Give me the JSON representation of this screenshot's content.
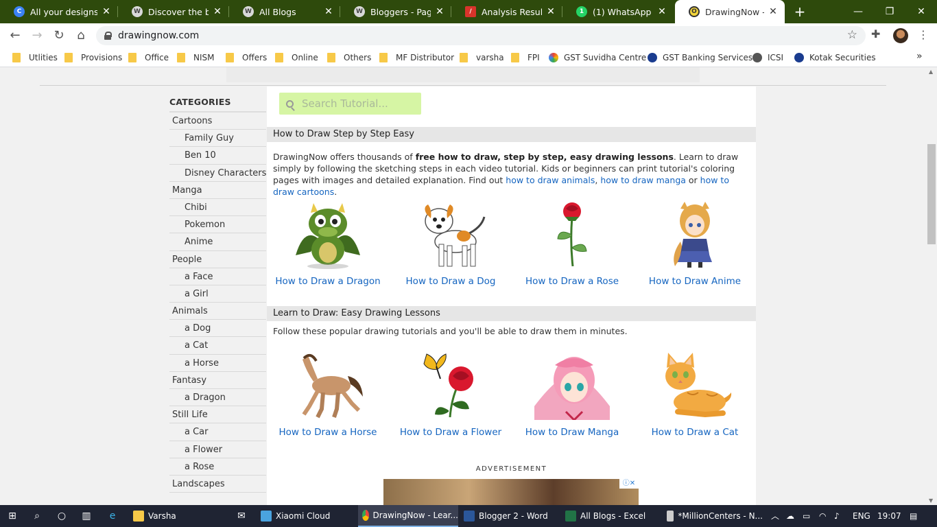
{
  "tabs": [
    {
      "title": "All your designs - ",
      "icon": "canva-icon",
      "icon_color": "#3b82f6",
      "icon_text": "C"
    },
    {
      "title": "Discover the best ",
      "icon": "wordpress-icon",
      "icon_color": "#d9d9d9",
      "icon_text": "W"
    },
    {
      "title": "All Blogs",
      "icon": "wordpress-icon",
      "icon_color": "#d9d9d9",
      "icon_text": "W"
    },
    {
      "title": "Bloggers - Page",
      "icon": "wordpress-icon",
      "icon_color": "#d9d9d9",
      "icon_text": "W"
    },
    {
      "title": "Analysis Result « L",
      "icon": "analysis-icon",
      "icon_color": "#d9342b",
      "icon_text": "/"
    },
    {
      "title": "(1) WhatsApp",
      "icon": "whatsapp-icon",
      "icon_color": "#25d366",
      "icon_text": "1"
    },
    {
      "title": "DrawingNow - Lea",
      "icon": "drawingnow-icon",
      "icon_color": "#f2d43a",
      "icon_text": "O"
    }
  ],
  "address": {
    "url": "drawingnow.com"
  },
  "bookmarks": [
    {
      "label": "Utlities",
      "type": "folder"
    },
    {
      "label": "Provisions",
      "type": "folder"
    },
    {
      "label": "Office",
      "type": "folder"
    },
    {
      "label": "NISM",
      "type": "folder"
    },
    {
      "label": "Offers",
      "type": "folder"
    },
    {
      "label": "Online",
      "type": "folder"
    },
    {
      "label": "Others",
      "type": "folder"
    },
    {
      "label": "MF Distributor",
      "type": "folder"
    },
    {
      "label": "varsha",
      "type": "folder"
    },
    {
      "label": "FPI",
      "type": "folder"
    },
    {
      "label": "GST Suvidha Centre",
      "type": "site",
      "color": "#e94235"
    },
    {
      "label": "GST Banking Services",
      "type": "site",
      "color": "#1a3c8f"
    },
    {
      "label": "ICSI",
      "type": "site",
      "color": "#555555"
    },
    {
      "label": "Kotak Securities",
      "type": "site",
      "color": "#1a3c8f"
    }
  ],
  "sidebar": {
    "title": "CATEGORIES",
    "items": [
      {
        "label": "Cartoons",
        "level": 0
      },
      {
        "label": "Family Guy",
        "level": 1
      },
      {
        "label": "Ben 10",
        "level": 1
      },
      {
        "label": "Disney Characters",
        "level": 1
      },
      {
        "label": "Manga",
        "level": 0
      },
      {
        "label": "Chibi",
        "level": 1
      },
      {
        "label": "Pokemon",
        "level": 1
      },
      {
        "label": "Anime",
        "level": 1
      },
      {
        "label": "People",
        "level": 0
      },
      {
        "label": "a Face",
        "level": 1
      },
      {
        "label": "a Girl",
        "level": 1
      },
      {
        "label": "Animals",
        "level": 0
      },
      {
        "label": "a Dog",
        "level": 1
      },
      {
        "label": "a Cat",
        "level": 1
      },
      {
        "label": "a Horse",
        "level": 1
      },
      {
        "label": "Fantasy",
        "level": 0
      },
      {
        "label": "a Dragon",
        "level": 1
      },
      {
        "label": "Still Life",
        "level": 0
      },
      {
        "label": "a Car",
        "level": 1
      },
      {
        "label": "a Flower",
        "level": 1
      },
      {
        "label": "a Rose",
        "level": 1
      },
      {
        "label": "Landscapes",
        "level": 0
      }
    ]
  },
  "search": {
    "placeholder": "Search Tutorial..."
  },
  "section1": {
    "heading": "How to Draw Step by Step Easy",
    "intro_a": "DrawingNow offers thousands of ",
    "intro_bold": "free how to draw, step by step, easy drawing lessons",
    "intro_b": ". Learn to draw simply by following the sketching steps in each video tutorial. Kids or beginners can print tutorial's coloring pages with images and detailed explanation. Find out ",
    "link_animals": "how to draw animals",
    "sep1": ", ",
    "link_manga": "how to draw manga",
    "sep2": " or ",
    "link_cartoons": "how to draw cartoons",
    "end": ".",
    "cards": [
      {
        "caption": "How to Draw a Dragon",
        "icon": "dragon-icon"
      },
      {
        "caption": "How to Draw a Dog",
        "icon": "dog-icon"
      },
      {
        "caption": "How to Draw a Rose",
        "icon": "rose-icon"
      },
      {
        "caption": "How to Draw Anime",
        "icon": "anime-icon"
      }
    ]
  },
  "section2": {
    "heading": "Learn to Draw: Easy Drawing Lessons",
    "intro": "Follow these popular drawing tutorials and you'll be able to draw them in minutes.",
    "cards": [
      {
        "caption": "How to Draw a Horse",
        "icon": "horse-icon"
      },
      {
        "caption": "How to Draw a Flower",
        "icon": "flower-icon"
      },
      {
        "caption": "How to Draw Manga",
        "icon": "manga-icon"
      },
      {
        "caption": "How to Draw a Cat",
        "icon": "cat-icon"
      }
    ]
  },
  "ad": {
    "label": "ADVERTISEMENT"
  },
  "taskbar": {
    "items": [
      {
        "label": "Varsha",
        "color": "#f7c948"
      },
      {
        "label": "Xiaomi Cloud",
        "color": "#4aa3df"
      },
      {
        "label": "DrawingNow - Lear...",
        "color": "#e8453c"
      },
      {
        "label": "Blogger 2 - Word",
        "color": "#2b579a"
      },
      {
        "label": "All Blogs - Excel",
        "color": "#217346"
      },
      {
        "label": "*MillionCenters - N...",
        "color": "#cccccc"
      }
    ],
    "lang": "ENG",
    "time": "19:07"
  },
  "colors": {
    "tabstrip": "#2e4a0c",
    "link": "#1565c0",
    "search_bg": "#d6f5a4"
  }
}
